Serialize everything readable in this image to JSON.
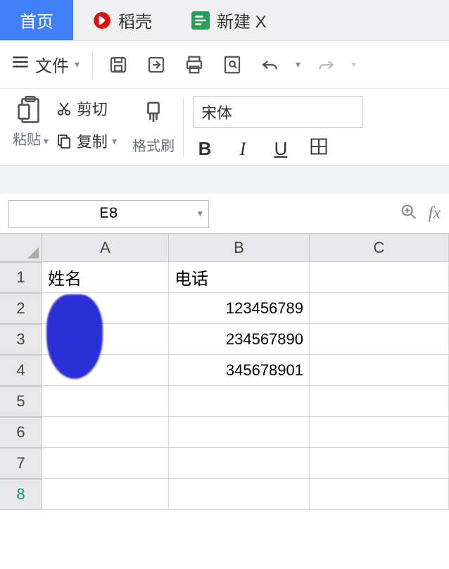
{
  "tabs": {
    "home": "首页",
    "docer": "稻壳",
    "new": "新建 X"
  },
  "menu": {
    "file": "文件"
  },
  "clipboard": {
    "paste": "粘贴",
    "cut": "剪切",
    "copy": "复制",
    "format_painter": "格式刷"
  },
  "font": {
    "name": "宋体"
  },
  "namebox": {
    "value": "E8"
  },
  "columns": [
    "A",
    "B",
    "C"
  ],
  "rows": [
    "1",
    "2",
    "3",
    "4",
    "5",
    "6",
    "7",
    "8"
  ],
  "cells": {
    "A1": "姓名",
    "B1": "电话",
    "B2": "123456789",
    "B3": "234567890",
    "B4": "345678901"
  }
}
